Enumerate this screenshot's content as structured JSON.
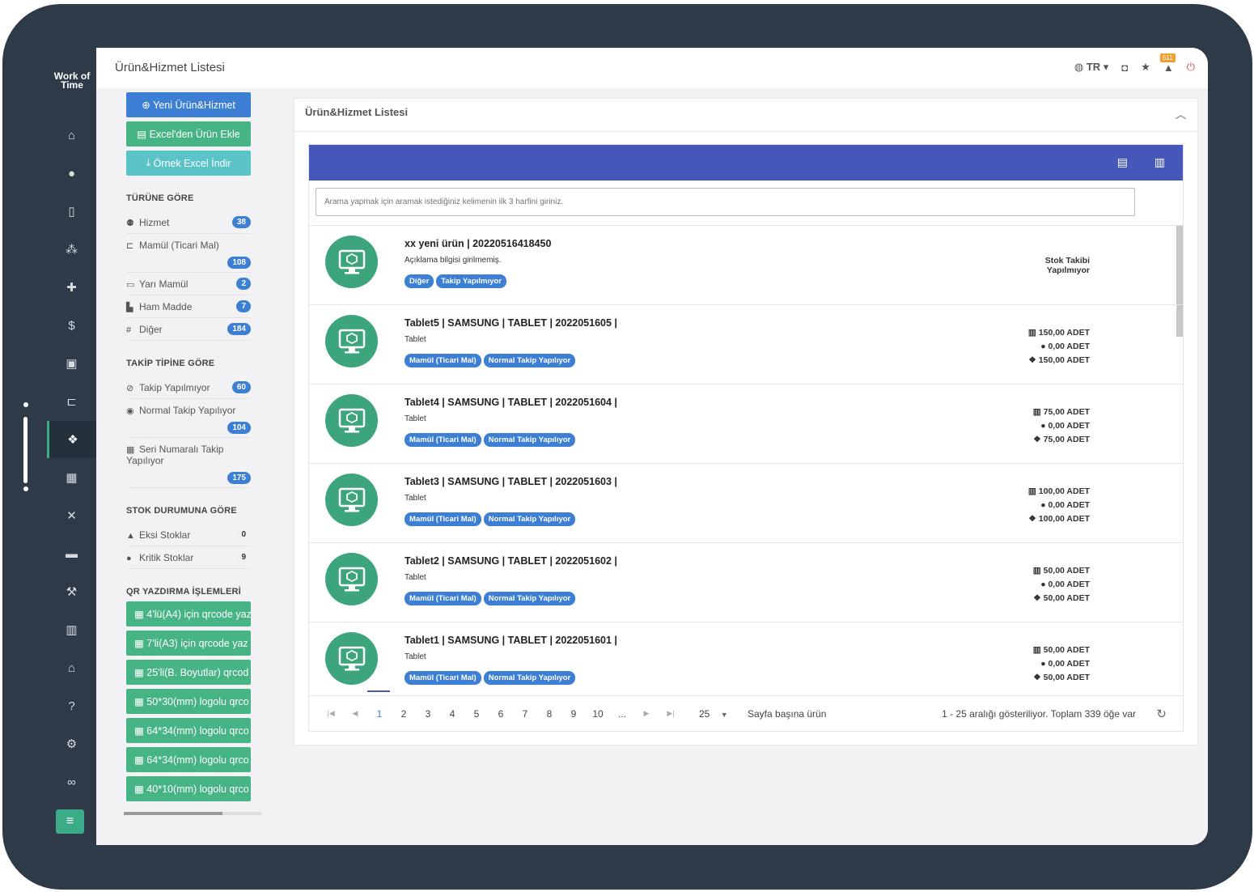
{
  "app": {
    "logo_line1": "Work of",
    "logo_line2": "Time",
    "page_title": "Ürün&Hizmet Listesi"
  },
  "topbar": {
    "lang": "TR",
    "notification_count": "511"
  },
  "actions": {
    "new_label": "Yeni Ürün&Hizmet",
    "excel_import_label": "Excel'den Ürün Ekle",
    "excel_sample_label": "Örnek Excel İndir"
  },
  "filters": {
    "by_type_title": "TÜRÜNE GÖRE",
    "by_type": [
      {
        "label": "Hizmet",
        "count": "38"
      },
      {
        "label": "Mamül (Ticari Mal)",
        "count": "108"
      },
      {
        "label": "Yarı Mamül",
        "count": "2"
      },
      {
        "label": "Ham Madde",
        "count": "7"
      },
      {
        "label": "Diğer",
        "count": "184"
      }
    ],
    "by_tracking_title": "TAKİP TİPİNE GÖRE",
    "by_tracking": [
      {
        "label": "Takip Yapılmıyor",
        "count": "60"
      },
      {
        "label": "Normal Takip Yapılıyor",
        "count": "104"
      },
      {
        "label": "Seri Numaralı Takip Yapılıyor",
        "count": "175"
      }
    ],
    "by_stock_title": "STOK DURUMUNA GÖRE",
    "by_stock": [
      {
        "label": "Eksi Stoklar",
        "count": "0"
      },
      {
        "label": "Kritik Stoklar",
        "count": "9"
      }
    ],
    "qr_title": "QR YAZDIRMA İŞLEMLERİ",
    "qr_buttons": [
      "4'lü(A4) için qrcode yaz",
      "7'li(A3) için qrcode yaz",
      "25'li(B. Boyutlar) qrcod",
      "50*30(mm) logolu qrco",
      "64*34(mm) logolu qrco",
      "64*34(mm) logolu qrco",
      "40*10(mm) logolu qrco"
    ]
  },
  "panel": {
    "title": "Ürün&Hizmet Listesi"
  },
  "search": {
    "placeholder": "Arama yapmak için aramak istediğiniz kelimenin ilk 3 harfini giriniz."
  },
  "products": [
    {
      "name": "xx yeni ürün | 20220516418450",
      "desc": "Açıklama bilgisi girilmemiş.",
      "tags": [
        "Diğer",
        "Takip Yapılmıyor"
      ],
      "stock_none": [
        "Stok Takibi",
        "Yapılmıyor"
      ]
    },
    {
      "name": "Tablet5 | SAMSUNG | TABLET | 2022051605 |",
      "desc": "Tablet",
      "tags": [
        "Mamül (Ticari Mal)",
        "Normal Takip Yapılıyor"
      ],
      "stock": [
        "150,00 ADET",
        "0,00 ADET",
        "150,00 ADET"
      ]
    },
    {
      "name": "Tablet4 | SAMSUNG | TABLET | 2022051604 |",
      "desc": "Tablet",
      "tags": [
        "Mamül (Ticari Mal)",
        "Normal Takip Yapılıyor"
      ],
      "stock": [
        "75,00 ADET",
        "0,00 ADET",
        "75,00 ADET"
      ]
    },
    {
      "name": "Tablet3 | SAMSUNG | TABLET | 2022051603 |",
      "desc": "Tablet",
      "tags": [
        "Mamül (Ticari Mal)",
        "Normal Takip Yapılıyor"
      ],
      "stock": [
        "100,00 ADET",
        "0,00 ADET",
        "100,00 ADET"
      ]
    },
    {
      "name": "Tablet2 | SAMSUNG | TABLET | 2022051602 |",
      "desc": "Tablet",
      "tags": [
        "Mamül (Ticari Mal)",
        "Normal Takip Yapılıyor"
      ],
      "stock": [
        "50,00 ADET",
        "0,00 ADET",
        "50,00 ADET"
      ]
    },
    {
      "name": "Tablet1 | SAMSUNG | TABLET | 2022051601 |",
      "desc": "Tablet",
      "tags": [
        "Mamül (Ticari Mal)",
        "Normal Takip Yapılıyor"
      ],
      "stock": [
        "50,00 ADET",
        "0,00 ADET",
        "50,00 ADET"
      ]
    }
  ],
  "pager": {
    "pages": [
      "1",
      "2",
      "3",
      "4",
      "5",
      "6",
      "7",
      "8",
      "9",
      "10",
      "..."
    ],
    "page_size": "25",
    "page_size_label": "Sayfa başına ürün",
    "info": "1 - 25 aralığı gösteriliyor. Toplam 339 öğe var"
  },
  "colors": {
    "frame": "#2f3a48",
    "accent_green": "#3cab88",
    "grid_toolbar": "#4557b8",
    "primary_blue": "#3d7fd4"
  }
}
